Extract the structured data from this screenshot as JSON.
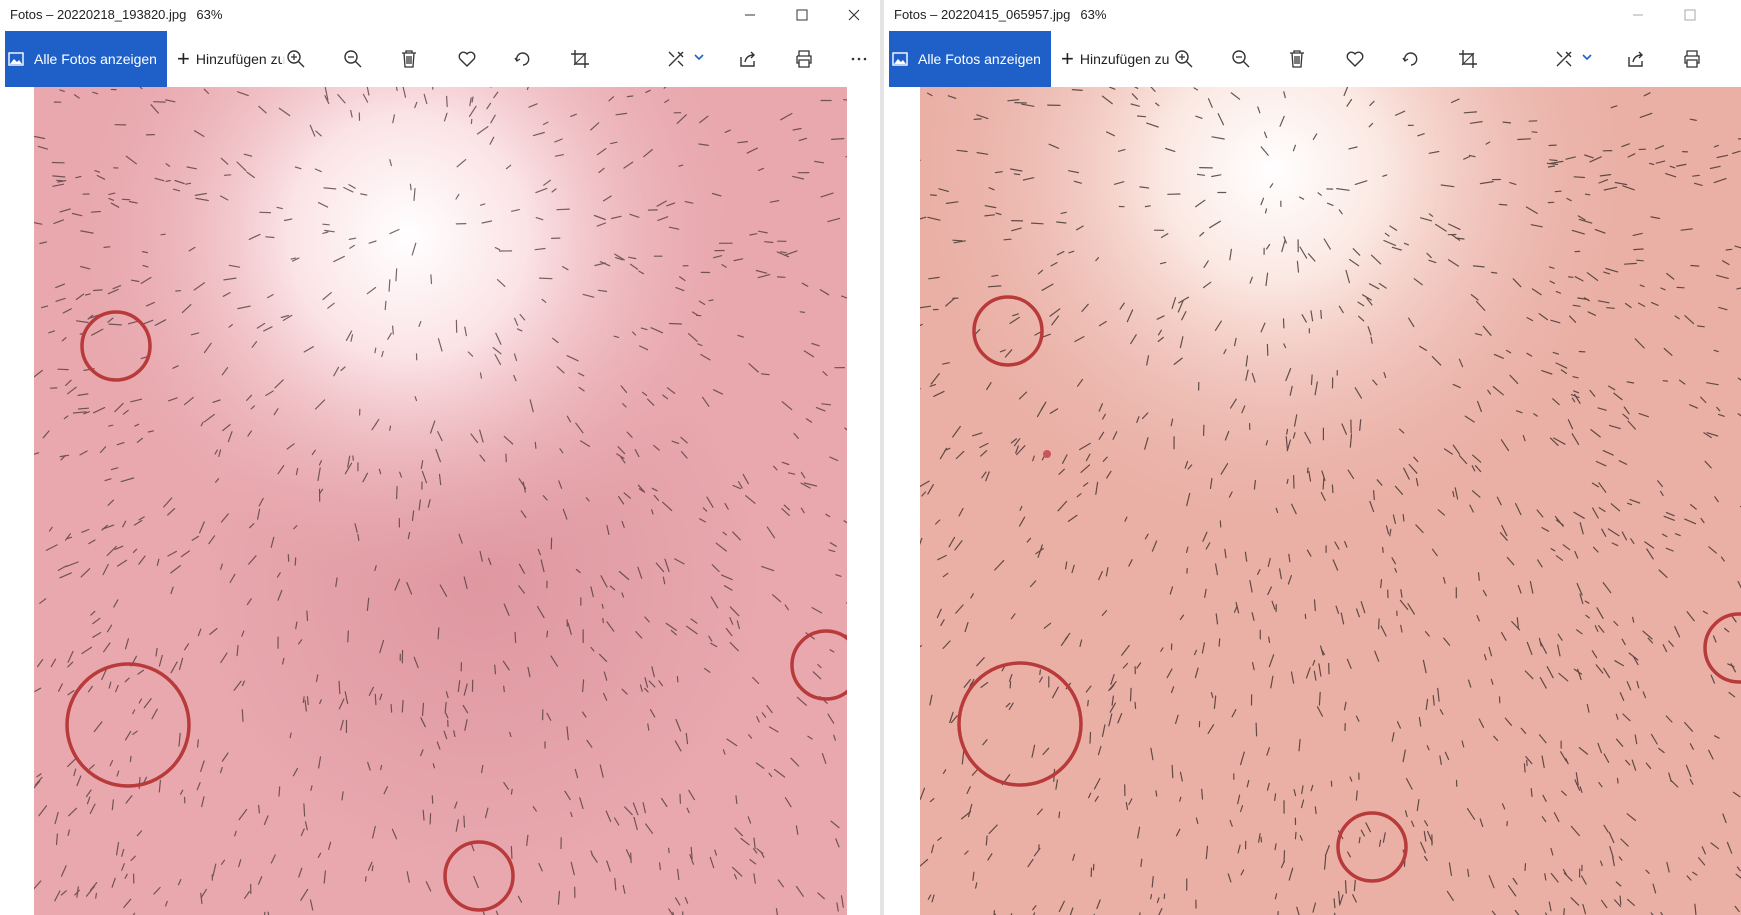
{
  "colors": {
    "accent": "#1f60c8",
    "marker": "#b83a3a",
    "skin_left": "#e8a8ae",
    "skin_right": "#eab0a6"
  },
  "windows": [
    {
      "app": "Fotos",
      "title": "Fotos – 20220218_193820.jpg",
      "zoom": "63%",
      "show_all_label": "Alle Fotos anzeigen",
      "add_label": "Hinzufügen zu",
      "window_controls": [
        "minimize-icon",
        "maximize-icon",
        "close-icon"
      ],
      "tools": [
        "zoom-in-icon",
        "zoom-out-icon",
        "delete-icon",
        "favorite-icon",
        "rotate-icon",
        "crop-icon",
        "edit-icon",
        "chevron-down-icon",
        "share-icon",
        "print-icon",
        "more-icon"
      ]
    },
    {
      "app": "Fotos",
      "title": "Fotos – 20220415_065957.jpg",
      "zoom": "63%",
      "show_all_label": "Alle Fotos anzeigen",
      "add_label": "Hinzufügen zu",
      "window_controls": [
        "minimize-icon",
        "maximize-icon"
      ],
      "tools": [
        "zoom-in-icon",
        "zoom-out-icon",
        "delete-icon",
        "favorite-icon",
        "rotate-icon",
        "crop-icon",
        "edit-icon",
        "chevron-down-icon",
        "share-icon",
        "print-icon"
      ]
    }
  ]
}
